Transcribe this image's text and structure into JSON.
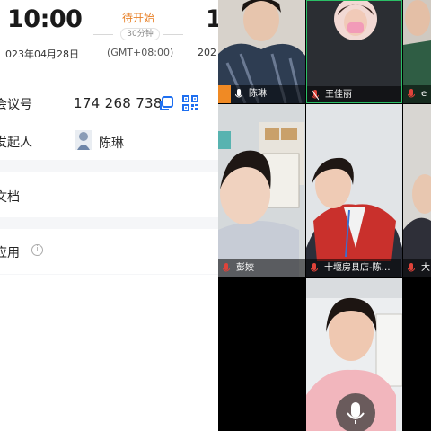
{
  "meeting": {
    "start_time": "10:00",
    "end_time": "1",
    "status": "待开始",
    "duration": "30分钟",
    "start_date": "023年04月28日",
    "timezone": "(GMT+08:00)",
    "end_date": "202",
    "status_color": "#e8832c"
  },
  "details": {
    "meeting_id_label": "会议号",
    "meeting_id": "174 268 738",
    "host_label": "发起人",
    "host_name": "陈琳",
    "docs_label": "文档",
    "apps_label": "应用",
    "info_icon_glyph": "i"
  },
  "participants": [
    {
      "name": "陈琳",
      "mic": "on",
      "color": "#ffffff"
    },
    {
      "name": "王佳丽",
      "mic": "off"
    },
    {
      "name": "e",
      "mic": "off"
    },
    {
      "name": "彭姣",
      "mic": "off"
    },
    {
      "name": "十堰房县店-陈…",
      "mic": "off"
    },
    {
      "name": "大",
      "mic": "off"
    }
  ],
  "icons": {
    "copy": "copy-icon",
    "qr": "qr-code-icon",
    "mic_muted": "mic-muted-icon",
    "mic": "mic-icon",
    "info": "info-icon"
  },
  "colors": {
    "accent_blue": "#1e6ff0",
    "mic_muted_red": "#e0433a"
  }
}
